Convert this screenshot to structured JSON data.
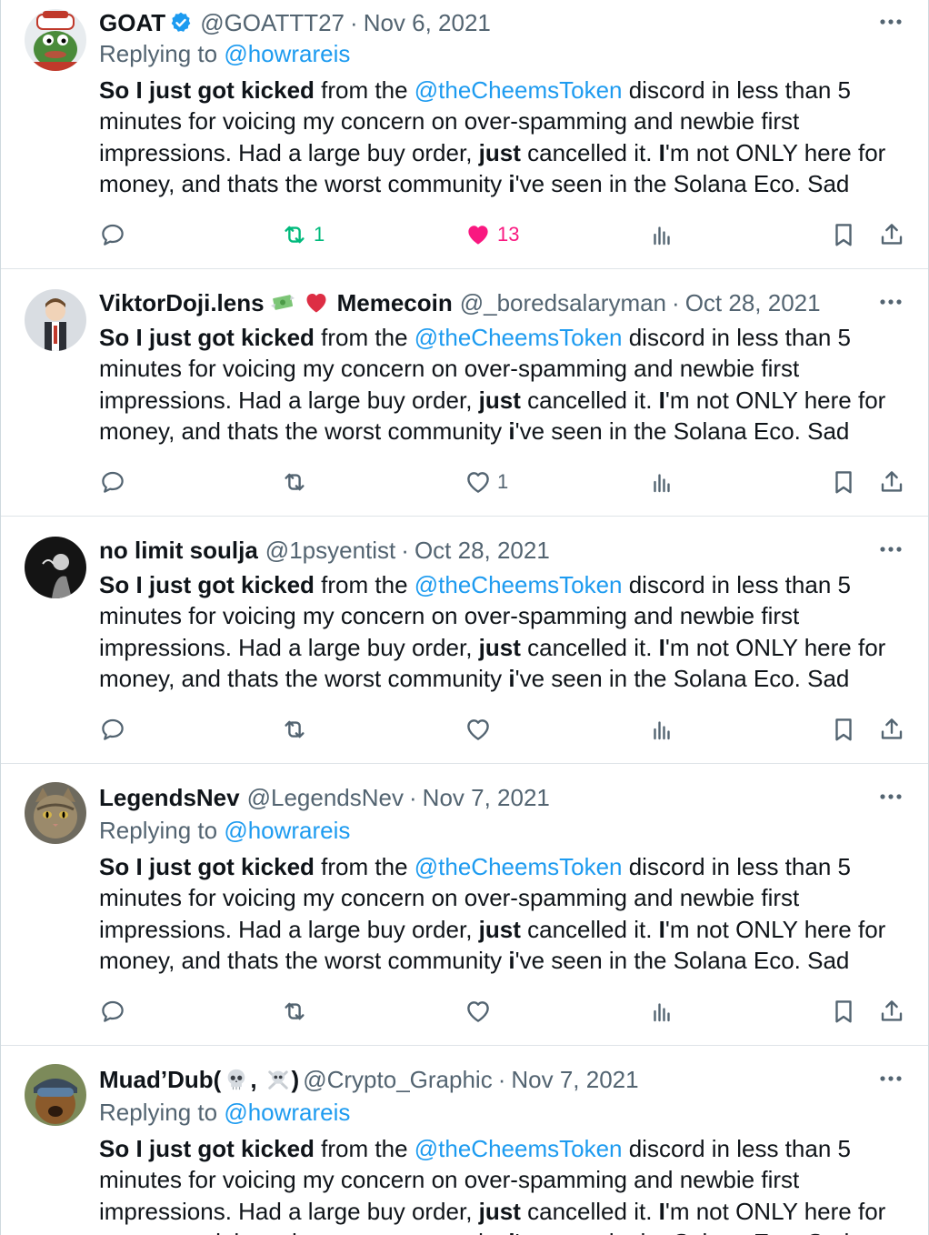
{
  "colors": {
    "link": "#1d9bf0",
    "muted": "#536471",
    "retweet_active": "#00ba7c",
    "like_active": "#f91880",
    "verified": "#1d9bf0"
  },
  "body_text": {
    "seg1_bold": "So I just got kicked",
    "seg2": " from the ",
    "mention": "@theCheemsToken",
    "seg3": " discord in less than 5 minutes for voicing my concern on over-spamming and newbie first impressions. Had a large buy order, ",
    "seg4_bold": "just",
    "seg5": " cancelled it. ",
    "seg6_bold": "I",
    "seg7": "'m not ONLY here for money, and thats the worst community ",
    "seg8_bold": "i",
    "seg9": "'ve seen in the Solana Eco. Sad"
  },
  "tweets": [
    {
      "name": "GOAT",
      "verified": true,
      "handle": "@GOATTT27",
      "sep": "·",
      "date": "Nov 6, 2021",
      "replying_prefix": "Replying to ",
      "replying_handle": "@howrareis",
      "retweets": "1",
      "likes": "13",
      "liked": true,
      "retweeted": true
    },
    {
      "name": "ViktorDoji.lens",
      "name_suffix": "Memecoin",
      "emojis": [
        "money-with-wings-icon",
        "red-heart-icon"
      ],
      "handle": "@_boredsalaryman",
      "sep": "·",
      "date": "Oct 28, 2021",
      "likes": "1"
    },
    {
      "name": "no limit soulja",
      "handle": "@1psyentist",
      "sep": "·",
      "date": "Oct 28, 2021"
    },
    {
      "name": "LegendsNev",
      "handle": "@LegendsNev",
      "sep": "·",
      "date": "Nov 7, 2021",
      "replying_prefix": "Replying to ",
      "replying_handle": "@howrareis"
    },
    {
      "name": "Muad’Dub(",
      "name_mid": ",",
      "name_end": ")",
      "emojis": [
        "skull-icon",
        "skull-crossbones-icon"
      ],
      "handle": "@Crypto_Graphic",
      "sep": "·",
      "date": "Nov 7, 2021",
      "replying_prefix": "Replying to ",
      "replying_handle": "@howrareis"
    }
  ]
}
